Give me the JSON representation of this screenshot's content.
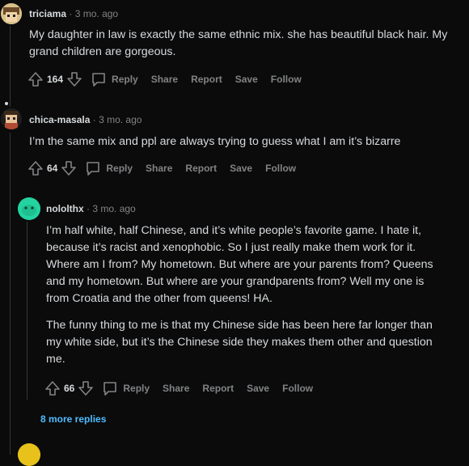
{
  "comments": [
    {
      "username": "triciama",
      "age": "3 mo. ago",
      "paragraphs": [
        "My daughter in law is exactly the same ethnic mix. she has beautiful black hair. My grand children are gorgeous."
      ],
      "votes": "164"
    },
    {
      "username": "chica-masala",
      "age": "3 mo. ago",
      "paragraphs": [
        "I’m the same mix and ppl are always trying to guess what I am it’s bizarre"
      ],
      "votes": "64"
    },
    {
      "username": "nololthx",
      "age": "3 mo. ago",
      "paragraphs": [
        "I’m half white, half Chinese, and it’s white people’s favorite game. I hate it, because it’s racist and xenophobic. So I just really make them work for it. Where am I from? My hometown. But where are your parents from? Queens and my hometown. But where are your grandparents from? Well my one is from Croatia and the other from queens! HA.",
        "The funny thing to me is that my Chinese side has been here far longer than my white side, but it’s the Chinese side they makes them other and question me."
      ],
      "votes": "66"
    }
  ],
  "actions": {
    "reply": "Reply",
    "share": "Share",
    "report": "Report",
    "save": "Save",
    "follow": "Follow"
  },
  "more_replies": "8 more replies",
  "colors": {
    "background": "#0b0b0c",
    "text": "#d7dadc",
    "muted": "#818384",
    "link": "#4fbcff",
    "avatar_teal": "#23d3a0"
  }
}
